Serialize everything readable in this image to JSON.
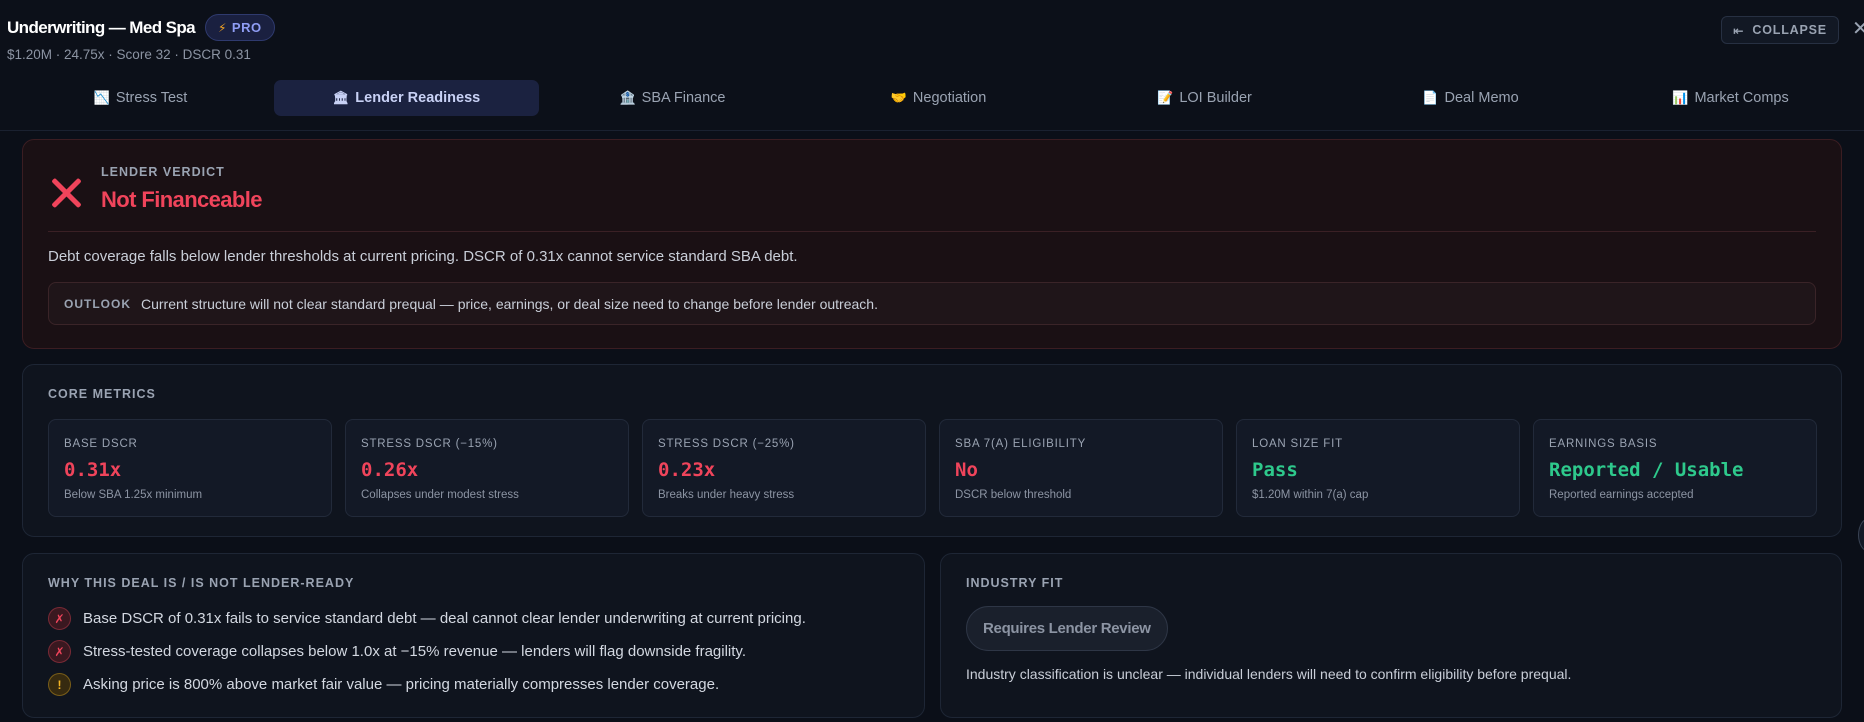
{
  "header": {
    "title": "Underwriting — Med Spa",
    "pro_label": "PRO",
    "subtitle": "$1.20M · 24.75x · Score 32 · DSCR 0.31",
    "collapse_label": "COLLAPSE",
    "close_label": "✕"
  },
  "tabs": [
    {
      "icon": "📉",
      "label": "Stress Test"
    },
    {
      "icon": "🏛",
      "label": "Lender Readiness"
    },
    {
      "icon": "🏦",
      "label": "SBA Finance"
    },
    {
      "icon": "🤝",
      "label": "Negotiation"
    },
    {
      "icon": "📝",
      "label": "LOI Builder"
    },
    {
      "icon": "📄",
      "label": "Deal Memo"
    },
    {
      "icon": "📊",
      "label": "Market Comps"
    }
  ],
  "active_tab": "Lender Readiness",
  "verdict": {
    "label": "LENDER VERDICT",
    "status": "Not Financeable",
    "description": "Debt coverage falls below lender thresholds at current pricing. DSCR of 0.31x cannot service standard SBA debt.",
    "outlook_label": "OUTLOOK",
    "outlook_text": "Current structure will not clear standard prequal — price, earnings, or deal size need to change before lender outreach."
  },
  "core_metrics": {
    "label": "CORE METRICS",
    "items": [
      {
        "label": "BASE DSCR",
        "value": "0.31x",
        "sub": "Below SBA 1.25x minimum",
        "tone": "red"
      },
      {
        "label": "STRESS DSCR (−15%)",
        "value": "0.26x",
        "sub": "Collapses under modest stress",
        "tone": "red"
      },
      {
        "label": "STRESS DSCR (−25%)",
        "value": "0.23x",
        "sub": "Breaks under heavy stress",
        "tone": "red"
      },
      {
        "label": "SBA 7(A) ELIGIBILITY",
        "value": "No",
        "sub": "DSCR below threshold",
        "tone": "red"
      },
      {
        "label": "LOAN SIZE FIT",
        "value": "Pass",
        "sub": "$1.20M within 7(a) cap",
        "tone": "green"
      },
      {
        "label": "EARNINGS BASIS",
        "value": "Reported / Usable",
        "sub": "Reported earnings accepted",
        "tone": "green"
      }
    ]
  },
  "why": {
    "label": "WHY THIS DEAL IS / IS NOT LENDER-READY",
    "items": [
      {
        "mark": "✗",
        "kind": "fail",
        "text": "Base DSCR of 0.31x fails to service standard debt — deal cannot clear lender underwriting at current pricing."
      },
      {
        "mark": "✗",
        "kind": "fail",
        "text": "Stress-tested coverage collapses below 1.0x at −15% revenue — lenders will flag downside fragility."
      },
      {
        "mark": "!",
        "kind": "warn",
        "text": "Asking price is 800% above market fair value — pricing materially compresses lender coverage."
      }
    ]
  },
  "industry": {
    "label": "INDUSTRY FIT",
    "pill": "Requires Lender Review",
    "description": "Industry classification is unclear — individual lenders will need to confirm eligibility before prequal."
  },
  "colors": {
    "background": "#0b0f18",
    "danger": "#f0445b",
    "success": "#2ec98c",
    "warning": "#f5b524",
    "accent": "#8f9df4"
  }
}
